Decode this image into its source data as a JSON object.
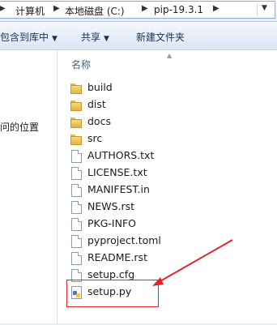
{
  "address": {
    "crumbs": [
      "计算机",
      "本地磁盘 (C:)",
      "pip-19.3.1"
    ],
    "separator": "▶",
    "dropdown_arrow": "▼"
  },
  "toolbar": {
    "include_in_library": "包含到库中",
    "share": "共享",
    "new_folder": "新建文件夹",
    "caret": "▼"
  },
  "nav": {
    "recent_places_partial": "问的位置"
  },
  "columns": {
    "name": "名称",
    "sort_caret": "▲"
  },
  "files": [
    {
      "name": "build",
      "type": "folder-icon"
    },
    {
      "name": "dist",
      "type": "folder-icon"
    },
    {
      "name": "docs",
      "type": "folder-icon"
    },
    {
      "name": "src",
      "type": "folder-icon"
    },
    {
      "name": "AUTHORS.txt",
      "type": "text-file-icon"
    },
    {
      "name": "LICENSE.txt",
      "type": "text-file-icon"
    },
    {
      "name": "MANIFEST.in",
      "type": "file-icon"
    },
    {
      "name": "NEWS.rst",
      "type": "file-icon"
    },
    {
      "name": "PKG-INFO",
      "type": "file-icon"
    },
    {
      "name": "pyproject.toml",
      "type": "file-icon"
    },
    {
      "name": "README.rst",
      "type": "file-icon"
    },
    {
      "name": "setup.cfg",
      "type": "file-icon"
    },
    {
      "name": "setup.py",
      "type": "python-file-icon"
    }
  ],
  "annotation": {
    "highlight_color": "#e0262a",
    "target": "setup.py"
  }
}
